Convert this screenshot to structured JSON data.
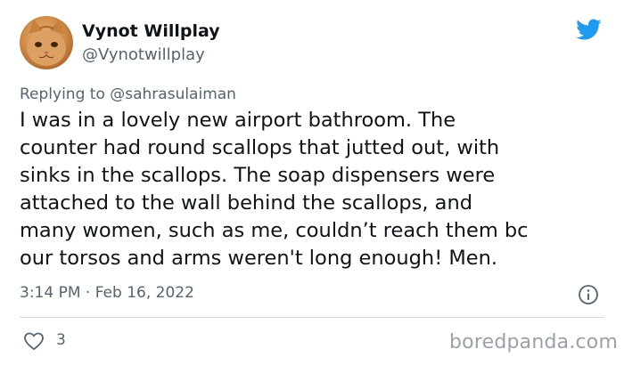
{
  "author": {
    "name": "Vynot Willplay",
    "handle": "@Vynotwillplay",
    "avatar": "orange-cat-photo"
  },
  "reply": {
    "prefix": "Replying to",
    "mention": "@sahrasulaiman"
  },
  "tweet": {
    "lines": [
      "I was in a lovely new airport bathroom. The",
      "counter had round scallops that jutted out, with",
      "sinks in the scallops. The soap dispensers were",
      "attached to the wall behind the scallops, and",
      "many women, such as me, couldn’t reach them bc",
      "our torsos and arms weren't long enough! Men."
    ]
  },
  "meta": {
    "timestamp": "3:14 PM · Feb 16, 2022"
  },
  "actions": {
    "like_count": "3"
  },
  "watermark": "boredpanda.com",
  "colors": {
    "twitter_blue": "#1d9bf0",
    "text": "#0f1419",
    "secondary": "#536471",
    "divider": "#cfd9de"
  },
  "icons": [
    "twitter-bird-icon",
    "info-icon",
    "heart-icon"
  ]
}
